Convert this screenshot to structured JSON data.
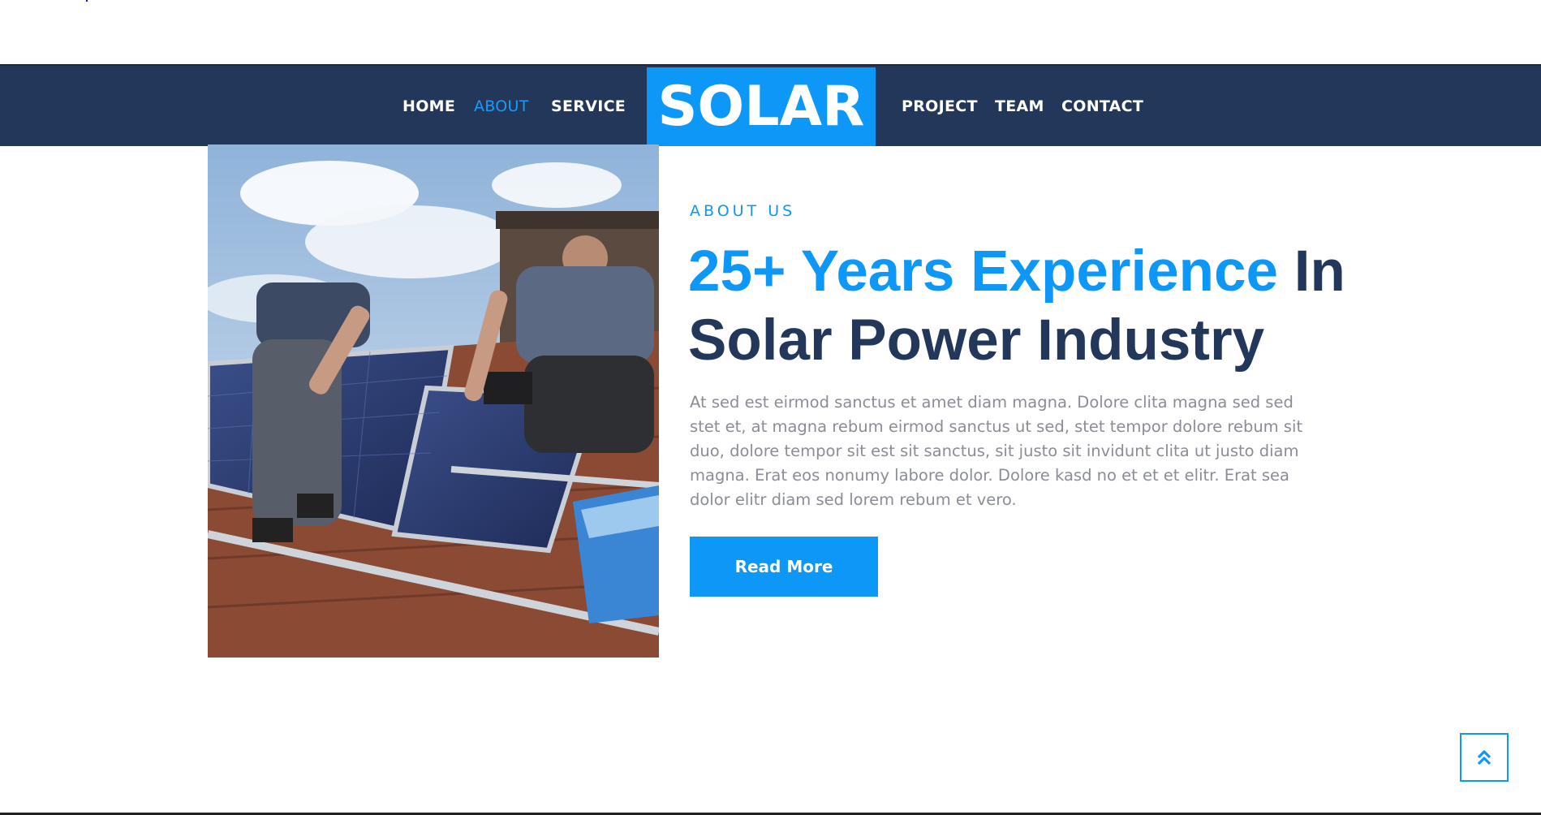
{
  "nav": {
    "left_links": [
      {
        "label": "HOME"
      },
      {
        "label": "ABOUT"
      },
      {
        "label": "SERVICE"
      }
    ],
    "brand": "SOLAR",
    "right_links": [
      {
        "label": "PROJECT"
      },
      {
        "label": "TEAM"
      },
      {
        "label": "CONTACT"
      }
    ],
    "active_label": "ABOUT"
  },
  "about": {
    "eyebrow": "ABOUT US",
    "headline_accent": "25+ Years Experience",
    "headline_rest": " In Solar Power Industry",
    "body": "At sed est eirmod sanctus et amet diam magna. Dolore clita magna sed sed stet et, at magna rebum eirmod sanctus ut sed, stet tempor dolore rebum sit duo, dolore tempor sit est sit sanctus, sit justo sit invidunt clita ut justo diam magna. Erat eos nonumy labore dolor. Dolore kasd no et et et elitr. Erat sea dolor elitr diam sed lorem rebum et vero.",
    "button_label": "Read More",
    "image_icon": "solar-installation-photo"
  },
  "back_to_top": {
    "icon": "double-chevron-up-icon"
  },
  "colors": {
    "navy": "#223759",
    "accent": "#0d97f6",
    "body_text": "#8b8d96"
  }
}
